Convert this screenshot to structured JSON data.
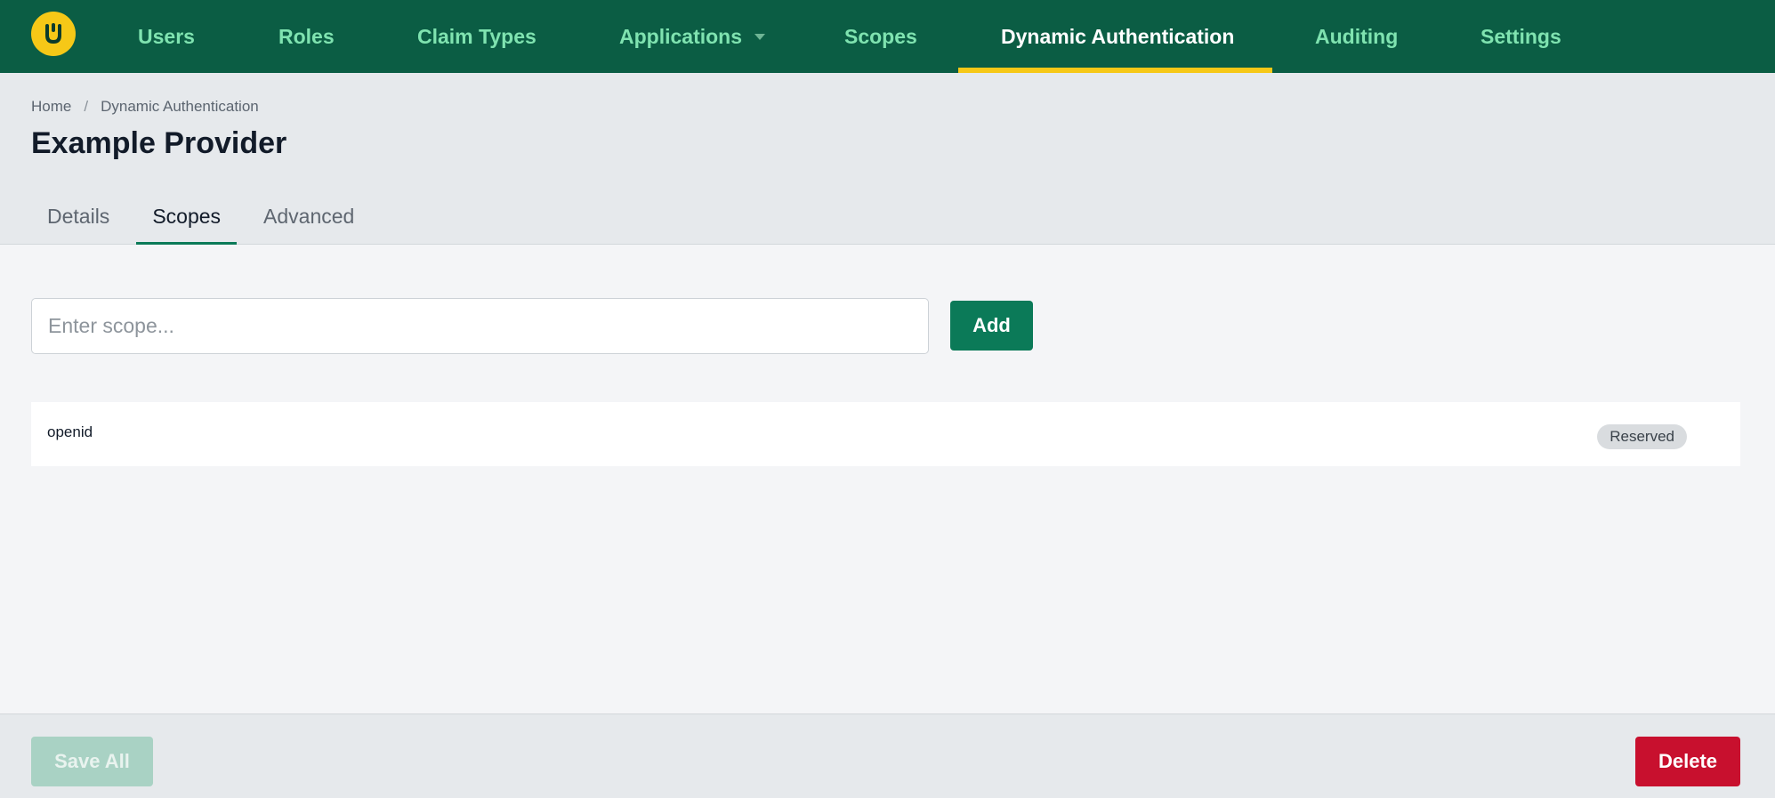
{
  "brand": {
    "logo_icon": "umbraco-u-logo",
    "accent": "#f6c817",
    "nav_bg": "#0b5d44"
  },
  "nav": {
    "items": [
      {
        "label": "Users"
      },
      {
        "label": "Roles"
      },
      {
        "label": "Claim Types"
      },
      {
        "label": "Applications",
        "has_dropdown": true
      },
      {
        "label": "Scopes"
      },
      {
        "label": "Dynamic Authentication",
        "active": true
      },
      {
        "label": "Auditing"
      },
      {
        "label": "Settings"
      }
    ]
  },
  "breadcrumb": {
    "home": "Home",
    "separator": "/",
    "current": "Dynamic Authentication"
  },
  "page": {
    "title": "Example Provider"
  },
  "tabs": [
    {
      "label": "Details"
    },
    {
      "label": "Scopes",
      "active": true
    },
    {
      "label": "Advanced"
    }
  ],
  "scope_form": {
    "input_value": "",
    "placeholder": "Enter scope...",
    "add_label": "Add"
  },
  "scopes": [
    {
      "name": "openid",
      "badge": "Reserved"
    }
  ],
  "footer": {
    "save_label": "Save All",
    "save_disabled": true,
    "delete_label": "Delete",
    "delete_color": "#c8102e"
  }
}
